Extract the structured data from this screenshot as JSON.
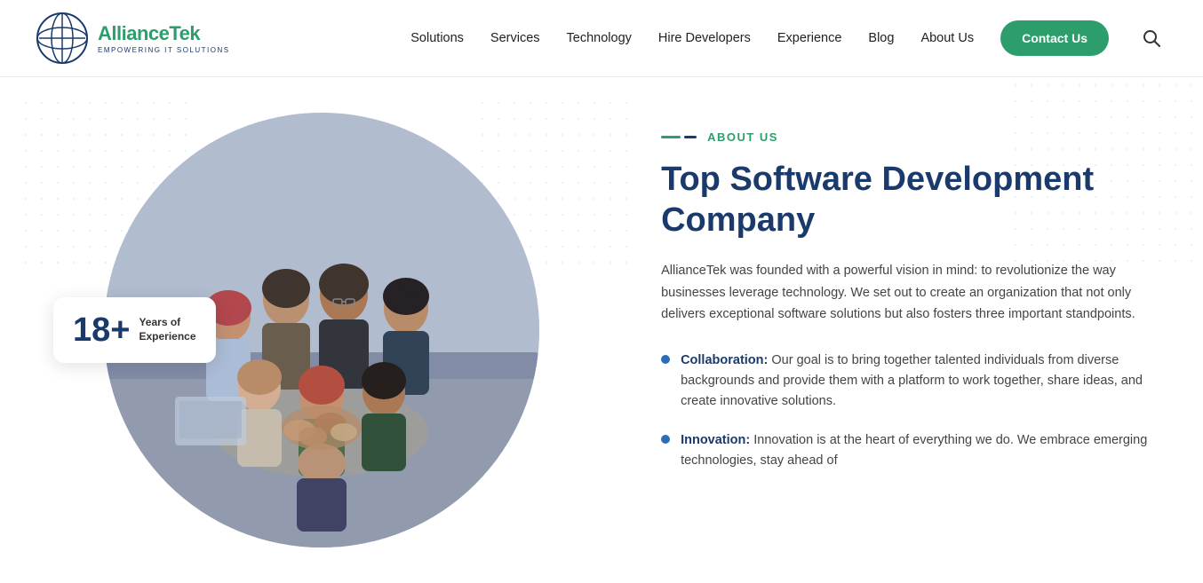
{
  "header": {
    "logo": {
      "brand_start": "Alliance",
      "brand_end": "Tek",
      "tagline": "EMPOWERING IT SOLUTIONS"
    },
    "nav": {
      "items": [
        {
          "label": "Solutions",
          "id": "solutions"
        },
        {
          "label": "Services",
          "id": "services"
        },
        {
          "label": "Technology",
          "id": "technology"
        },
        {
          "label": "Hire Developers",
          "id": "hire-developers"
        },
        {
          "label": "Experience",
          "id": "experience"
        },
        {
          "label": "Blog",
          "id": "blog"
        },
        {
          "label": "About Us",
          "id": "about-us"
        }
      ],
      "contact_button": "Contact Us"
    }
  },
  "main": {
    "left": {
      "badge": {
        "number": "18+",
        "line1": "Years of",
        "line2": "Experience"
      }
    },
    "right": {
      "section_label": "ABOUT US",
      "heading": "Top Software Development Company",
      "description": "AllianceTek was founded with a powerful vision in mind: to revolutionize the way businesses leverage technology. We set out to create an organization that not only delivers exceptional software solutions but also fosters three important standpoints.",
      "bullets": [
        {
          "title": "Collaboration:",
          "text": " Our goal is to bring together talented individuals from diverse backgrounds and provide them with a platform to work together, share ideas, and create innovative solutions."
        },
        {
          "title": "Innovation:",
          "text": " Innovation is at the heart of everything we do. We embrace emerging technologies, stay ahead of"
        }
      ]
    }
  }
}
